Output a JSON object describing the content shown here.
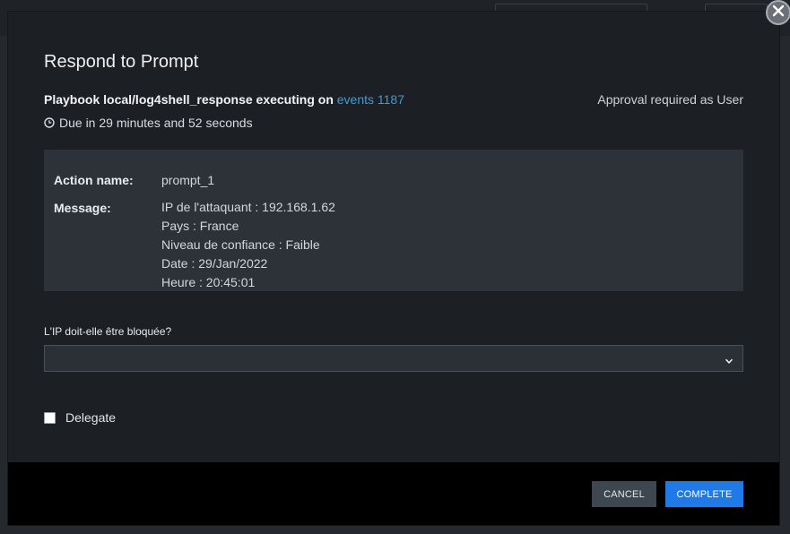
{
  "modal": {
    "title": "Respond to Prompt",
    "playbook_prefix": "Playbook local/log4shell_response executing on",
    "playbook_link": "events 1187",
    "approval": "Approval required as User",
    "due": "Due in 29 minutes and 52 seconds",
    "details": {
      "action_label": "Action name:",
      "action_value": "prompt_1",
      "message_label": "Message:",
      "message_lines": [
        "IP de l'attaquant : 192.168.1.62",
        "Pays : France",
        "Niveau de confiance : Faible",
        "Date : 29/Jan/2022",
        "Heure : 20:45:01"
      ]
    },
    "question": "L'IP doit-elle être bloquée?",
    "select_value": "",
    "delegate_label": "Delegate",
    "delegate_checked": false,
    "buttons": {
      "cancel": "CANCEL",
      "complete": "COMPLETE"
    }
  },
  "icons": {
    "close": "close-icon",
    "clock": "clock-icon",
    "chevron": "chevron-down-icon"
  },
  "colors": {
    "accent": "#1f7ae8",
    "link": "#3e9bd6",
    "modal_bg": "#1c2025",
    "details_bg": "#2d3238"
  }
}
